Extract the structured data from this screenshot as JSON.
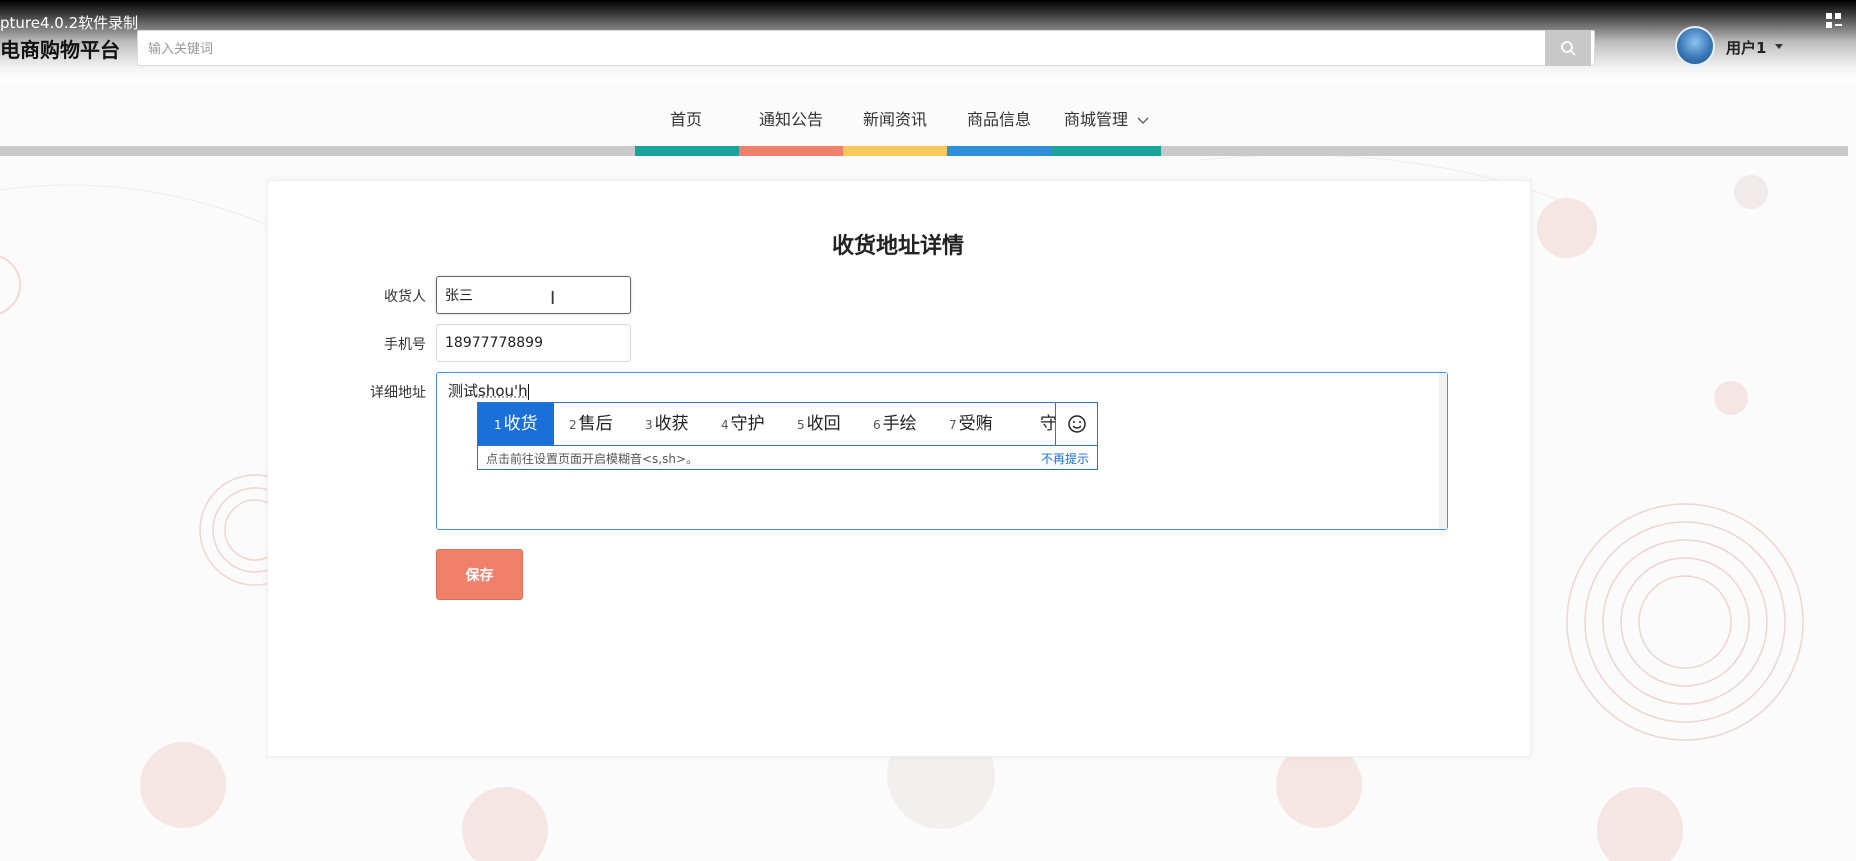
{
  "recorder": {
    "text": "pture4.0.2软件录制"
  },
  "header": {
    "brand": "电商购物平台",
    "search_placeholder": "输入关键词",
    "user_name": "用户1"
  },
  "nav": {
    "items": [
      "首页",
      "通知公告",
      "新闻资讯",
      "商品信息",
      "商城管理"
    ],
    "colors": [
      "#1aa39a",
      "#f0806a",
      "#f7c85a",
      "#2f8fd8",
      "#1aa39a"
    ]
  },
  "form": {
    "title": "收货地址详情",
    "consignee_label": "收货人",
    "consignee_value": "张三",
    "phone_label": "手机号",
    "phone_value": "18977778899",
    "address_label": "详细地址",
    "address_committed": "测试",
    "address_typing": "shou'h",
    "save_label": "保存"
  },
  "ime": {
    "candidates": [
      {
        "num": "1",
        "text": "收货"
      },
      {
        "num": "2",
        "text": "售后"
      },
      {
        "num": "3",
        "text": "收获"
      },
      {
        "num": "4",
        "text": "守护"
      },
      {
        "num": "5",
        "text": "收回"
      },
      {
        "num": "6",
        "text": "手绘"
      },
      {
        "num": "7",
        "text": "受贿"
      },
      {
        "num": "",
        "text": "守"
      }
    ],
    "hint": "点击前往设置页面开启模糊音<s,sh>。",
    "dismiss": "不再提示"
  },
  "colors": {
    "accent": "#f0806a",
    "ime_blue": "#1a6fd9"
  }
}
